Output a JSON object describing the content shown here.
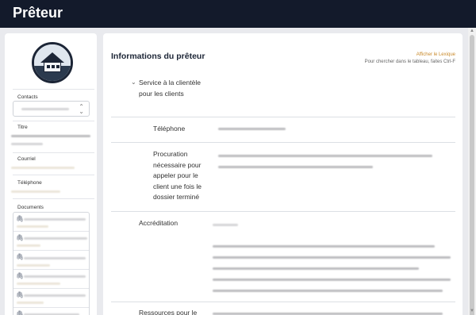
{
  "app": {
    "title": "Prêteur"
  },
  "sidebar": {
    "contacts_label": "Contacts",
    "titre_label": "Titre",
    "courriel_label": "Courriel",
    "telephone_label": "Téléphone",
    "documents_label": "Documents"
  },
  "main": {
    "title": "Informations du prêteur",
    "lexicon_link": "Afficher le Lexique",
    "search_hint": "Pour chercher dans le tableau, faites Ctrl-F",
    "section1_title": "Service à la clientèle pour les clients",
    "row_telephone": "Téléphone",
    "row_procuration": "Procuration nécessaire pour appeler pour le client une fois le dossier terminé",
    "row_accreditation": "Accréditation",
    "section2_title": "Ressources pour le"
  },
  "icons": {
    "chevron": "chevron-down-icon",
    "paperclip": "paperclip-icon",
    "select_arrows": "updown-chevron-icon"
  },
  "colors": {
    "topbar": "#131a2b",
    "accent_link": "#c98a2b"
  }
}
